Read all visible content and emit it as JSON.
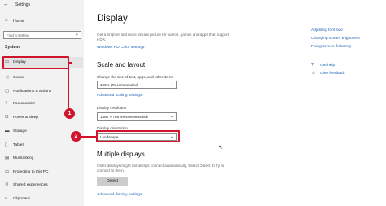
{
  "window": {
    "title": "Settings"
  },
  "sidebar": {
    "home": "Home",
    "search_placeholder": "Find a setting",
    "section": "System",
    "items": [
      {
        "label": "Display",
        "icon": "monitor-icon",
        "glyph": "▭"
      },
      {
        "label": "Sound",
        "icon": "speaker-icon",
        "glyph": "◁"
      },
      {
        "label": "Notifications & actions",
        "icon": "notifications-icon",
        "glyph": "▢"
      },
      {
        "label": "Focus assist",
        "icon": "moon-icon",
        "glyph": "☾"
      },
      {
        "label": "Power & sleep",
        "icon": "power-icon",
        "glyph": "⏻"
      },
      {
        "label": "Storage",
        "icon": "storage-icon",
        "glyph": "▬"
      },
      {
        "label": "Tablet",
        "icon": "tablet-icon",
        "glyph": "▯"
      },
      {
        "label": "Multitasking",
        "icon": "multitasking-icon",
        "glyph": "▤"
      },
      {
        "label": "Projecting to this PC",
        "icon": "projecting-icon",
        "glyph": "▭"
      },
      {
        "label": "Shared experiences",
        "icon": "shared-experiences-icon",
        "glyph": "✕"
      },
      {
        "label": "Clipboard",
        "icon": "clipboard-icon",
        "glyph": "▫"
      }
    ]
  },
  "main": {
    "title": "Display",
    "hdr_desc": "Get a brighter and more vibrant picture for videos, games and apps that support HDR.",
    "hdr_link": "Windows HD Color settings",
    "scale_heading": "Scale and layout",
    "scale_label": "Change the size of text, apps, and other items",
    "scale_value": "100% (Recommended)",
    "advanced_scaling": "Advanced scaling settings",
    "resolution_label": "Display resolution",
    "resolution_value": "1360 × 768 (Recommended)",
    "orientation_label": "Display orientation",
    "orientation_value": "Landscape",
    "multiple_heading": "Multiple displays",
    "multiple_desc": "Older displays might not always connect automatically. Select Detect to try to connect to them.",
    "detect_button": "Detect",
    "advanced_display": "Advanced display settings"
  },
  "right_panel": {
    "links": [
      "Adjusting font size",
      "Changing screen brightness",
      "Fixing screen flickering"
    ],
    "get_help": "Get help",
    "give_feedback": "Give feedback"
  },
  "annotations": {
    "badge1": "1",
    "badge2": "2",
    "color": "#d0142c"
  },
  "colors": {
    "accent": "#0063b1",
    "link": "#1a5fb4",
    "annotation": "#d0142c"
  }
}
